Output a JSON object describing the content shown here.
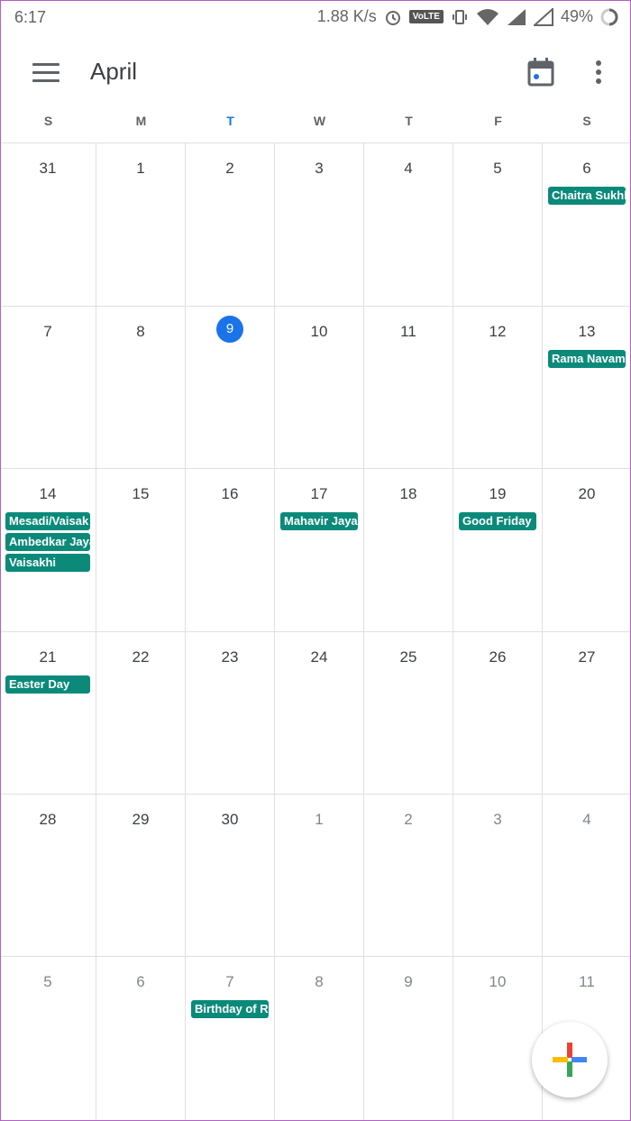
{
  "status_bar": {
    "time": "6:17",
    "speed": "1.88 K/s",
    "volte": "VoLTE",
    "battery": "49%"
  },
  "app_bar": {
    "title": "April",
    "menu_icon": "hamburger-menu-icon",
    "calendar_icon": "calendar-today-icon",
    "more_icon": "more-vert-icon"
  },
  "weekdays": [
    "S",
    "M",
    "T",
    "W",
    "T",
    "F",
    "S"
  ],
  "today_weekday_index": 2,
  "colors": {
    "accent": "#1a73e8",
    "event": "#0b8a7a"
  },
  "weeks": [
    [
      {
        "day": "31",
        "dim": false,
        "events": []
      },
      {
        "day": "1",
        "dim": false,
        "events": []
      },
      {
        "day": "2",
        "dim": false,
        "events": []
      },
      {
        "day": "3",
        "dim": false,
        "events": []
      },
      {
        "day": "4",
        "dim": false,
        "events": []
      },
      {
        "day": "5",
        "dim": false,
        "events": []
      },
      {
        "day": "6",
        "dim": false,
        "events": [
          "Chaitra Sukhlad"
        ]
      }
    ],
    [
      {
        "day": "7",
        "dim": false,
        "events": []
      },
      {
        "day": "8",
        "dim": false,
        "events": []
      },
      {
        "day": "9",
        "dim": false,
        "today": true,
        "events": []
      },
      {
        "day": "10",
        "dim": false,
        "events": []
      },
      {
        "day": "11",
        "dim": false,
        "events": []
      },
      {
        "day": "12",
        "dim": false,
        "events": []
      },
      {
        "day": "13",
        "dim": false,
        "events": [
          "Rama Navami"
        ]
      }
    ],
    [
      {
        "day": "14",
        "dim": false,
        "events": [
          "Mesadi/Vaisak",
          "Ambedkar Jaya",
          "Vaisakhi"
        ]
      },
      {
        "day": "15",
        "dim": false,
        "events": []
      },
      {
        "day": "16",
        "dim": false,
        "events": []
      },
      {
        "day": "17",
        "dim": false,
        "events": [
          "Mahavir Jayant"
        ]
      },
      {
        "day": "18",
        "dim": false,
        "events": []
      },
      {
        "day": "19",
        "dim": false,
        "events": [
          "Good Friday"
        ]
      },
      {
        "day": "20",
        "dim": false,
        "events": []
      }
    ],
    [
      {
        "day": "21",
        "dim": false,
        "events": [
          "Easter Day"
        ]
      },
      {
        "day": "22",
        "dim": false,
        "events": []
      },
      {
        "day": "23",
        "dim": false,
        "events": []
      },
      {
        "day": "24",
        "dim": false,
        "events": []
      },
      {
        "day": "25",
        "dim": false,
        "events": []
      },
      {
        "day": "26",
        "dim": false,
        "events": []
      },
      {
        "day": "27",
        "dim": false,
        "events": []
      }
    ],
    [
      {
        "day": "28",
        "dim": false,
        "events": []
      },
      {
        "day": "29",
        "dim": false,
        "events": []
      },
      {
        "day": "30",
        "dim": false,
        "events": []
      },
      {
        "day": "1",
        "dim": true,
        "events": []
      },
      {
        "day": "2",
        "dim": true,
        "events": []
      },
      {
        "day": "3",
        "dim": true,
        "events": []
      },
      {
        "day": "4",
        "dim": true,
        "events": []
      }
    ],
    [
      {
        "day": "5",
        "dim": true,
        "events": []
      },
      {
        "day": "6",
        "dim": true,
        "events": []
      },
      {
        "day": "7",
        "dim": true,
        "events": [
          "Birthday of Rav"
        ]
      },
      {
        "day": "8",
        "dim": true,
        "events": []
      },
      {
        "day": "9",
        "dim": true,
        "events": []
      },
      {
        "day": "10",
        "dim": true,
        "events": []
      },
      {
        "day": "11",
        "dim": true,
        "events": []
      }
    ]
  ],
  "fab": {
    "icon": "add-plus-icon"
  }
}
